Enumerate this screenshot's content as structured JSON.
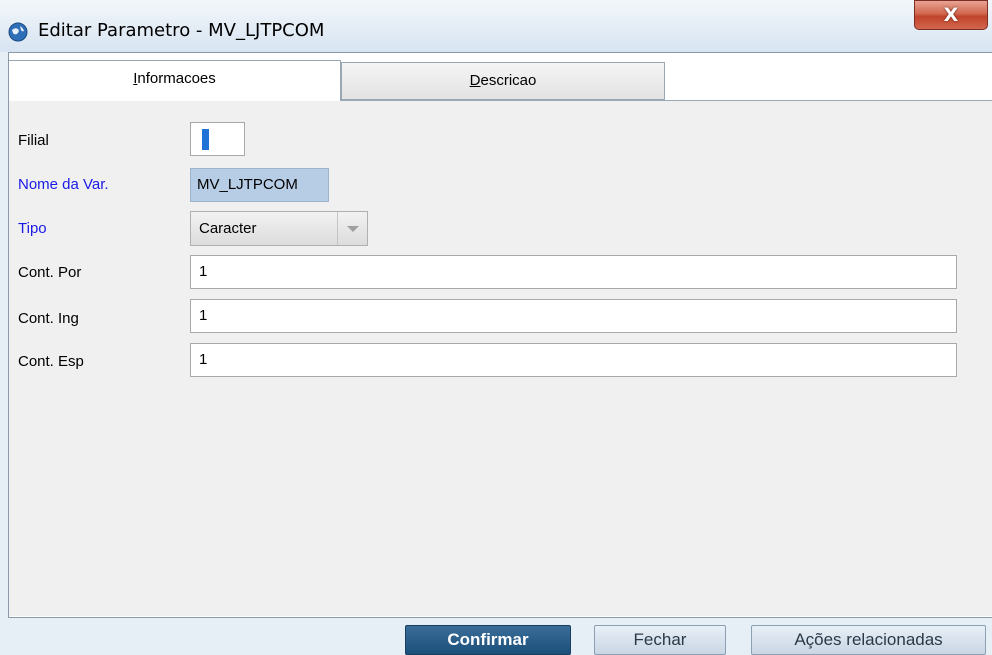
{
  "window": {
    "title": "Editar Parametro - MV_LJTPCOM",
    "close_glyph": "X",
    "icon": "app-globe-icon"
  },
  "tabs": [
    {
      "label_underlined": "I",
      "label_rest": "nformacoes",
      "active": true
    },
    {
      "label_underlined": "D",
      "label_rest": "escricao",
      "active": false
    }
  ],
  "form": {
    "filial": {
      "label": "Filial",
      "value": ""
    },
    "nome_var": {
      "label": "Nome da Var.",
      "value": "MV_LJTPCOM"
    },
    "tipo": {
      "label": "Tipo",
      "value": "Caracter"
    },
    "cont_por": {
      "label": "Cont. Por",
      "value": "1"
    },
    "cont_ing": {
      "label": "Cont. Ing",
      "value": "1"
    },
    "cont_esp": {
      "label": "Cont. Esp",
      "value": "1"
    }
  },
  "buttons": {
    "confirmar": "Confirmar",
    "fechar": "Fechar",
    "acoes": "Ações relacionadas"
  },
  "colors": {
    "required_label": "#1a1ae6",
    "primary_button": "#1d4f7c",
    "close_button": "#c1442b"
  }
}
